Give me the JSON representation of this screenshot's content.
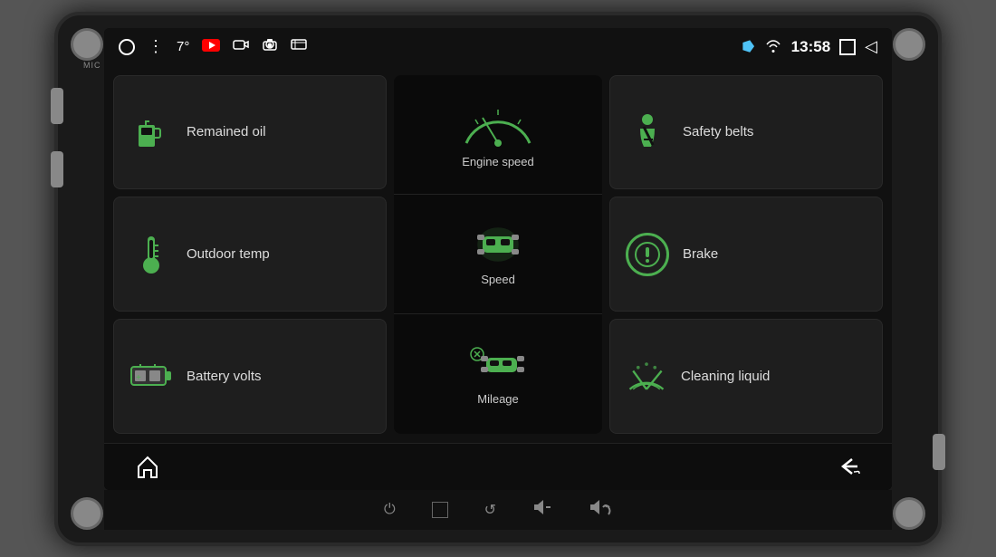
{
  "device": {
    "mic_label": "MIC"
  },
  "status_bar": {
    "temp": "7°",
    "time": "13:58",
    "icons": {
      "home": "○",
      "menu": "⋮",
      "youtube": "▶",
      "camera1": "◻",
      "camera2": "◻",
      "camera3": "◻",
      "bluetooth": "⚡",
      "wifi": "📶",
      "window": "☐",
      "back": "◁"
    }
  },
  "tiles": {
    "remained_oil": {
      "label": "Remained oil"
    },
    "outdoor_temp": {
      "label": "Outdoor temp"
    },
    "battery_volts": {
      "label": "Battery volts"
    },
    "safety_belts": {
      "label": "Safety belts"
    },
    "brake": {
      "label": "Brake"
    },
    "cleaning_liquid": {
      "label": "Cleaning liquid"
    }
  },
  "center_panel": {
    "engine_speed": {
      "label": "Engine speed"
    },
    "speed": {
      "label": "Speed"
    },
    "mileage": {
      "label": "Mileage"
    }
  },
  "bottom_bar": {
    "home": "⌂",
    "back": "↩"
  },
  "physical_buttons": {
    "power": "⏻",
    "home": "◻",
    "back": "↺",
    "vol_down": "🔈",
    "vol_up": "🔊"
  }
}
